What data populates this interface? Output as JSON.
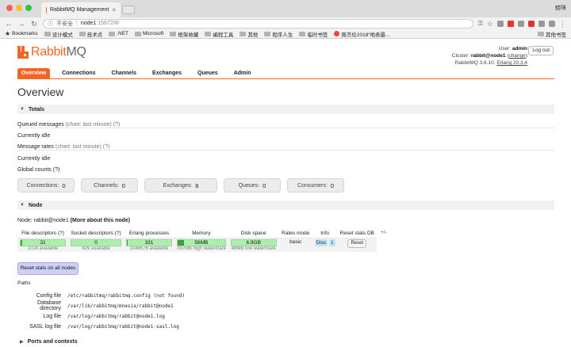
{
  "browser": {
    "tab_title": "RabbitMQ Management",
    "tab_close": "×",
    "user": "蛙咪",
    "insecure_label": "不安全",
    "separator": "|",
    "url_host": "node1",
    "url_path": ":15672/#/",
    "bookmarks": [
      "Bookmarks",
      "设计模式",
      "技术点",
      ".NET",
      "Microsoft",
      "框架收藏",
      "编程工具",
      "其他",
      "程序人生",
      "临时书签",
      "周杰伦2018“地表最..."
    ],
    "other_bookmarks": "其他书签"
  },
  "header": {
    "logo_text_a": "Rabbit",
    "logo_text_b": "MQ",
    "user_label": "User:",
    "user_value": "admin",
    "cluster_label": "Cluster:",
    "cluster_value": "rabbit@node1",
    "change_open": "(",
    "change_label": "change",
    "change_close": ")",
    "version_text": "RabbitMQ 3.6.10,",
    "erlang_text": "Erlang 20.3.4",
    "logout": "Log out"
  },
  "tabs": [
    "Overview",
    "Connections",
    "Channels",
    "Exchanges",
    "Queues",
    "Admin"
  ],
  "page_title": "Overview",
  "totals": {
    "section": "Totals",
    "queued_label": "Queued messages",
    "queued_hint": "(chart: last minute) (?)",
    "idle1": "Currently idle",
    "rates_label": "Message rates",
    "rates_hint": "(chart: last minute) (?)",
    "idle2": "Currently idle",
    "global_counts": "Global counts (?)",
    "counts": [
      {
        "label": "Connections:",
        "value": "0"
      },
      {
        "label": "Channels:",
        "value": "0"
      },
      {
        "label": "Exchanges:",
        "value": "8"
      },
      {
        "label": "Queues:",
        "value": "0"
      },
      {
        "label": "Consumers:",
        "value": "0"
      }
    ]
  },
  "node": {
    "section": "Node",
    "node_label": "Node: rabbit@node1",
    "more_link": "(More about this node)",
    "headers": [
      "File descriptors (?)",
      "Socket descriptors (?)",
      "Erlang processes",
      "Memory",
      "Disk space",
      "Rates mode",
      "Info",
      "Reset stats DB"
    ],
    "plusminus": "+/-",
    "file_desc": {
      "value": "31",
      "sub": "1024 available",
      "fraction": 0.03
    },
    "socket_desc": {
      "value": "0",
      "sub": "829 available",
      "fraction": 0.0
    },
    "erlang_proc": {
      "value": "331",
      "sub": "1048576 available",
      "fraction": 0.003
    },
    "memory": {
      "value": "56MB",
      "sub": "397MB high watermark",
      "fraction": 0.14
    },
    "disk": {
      "value": "6.9GB",
      "sub": "48MB low watermark",
      "fraction": 0.0
    },
    "rates_mode": "basic",
    "info_badges": [
      "Disc",
      "1"
    ],
    "reset_label": "Reset",
    "reset_all": "Reset stats on all nodes"
  },
  "paths": {
    "title": "Paths",
    "rows": [
      {
        "label": "Config file",
        "value": "/etc/rabbitmq/rabbitmq.config (not found)"
      },
      {
        "label": "Database directory",
        "value": "/var/lib/rabbitmq/mnesia/rabbit@node1"
      },
      {
        "label": "Log file",
        "value": "/var/log/rabbitmq/rabbit@node1.log"
      },
      {
        "label": "SASL log file",
        "value": "/var/log/rabbitmq/rabbit@node1-sasl.log"
      }
    ]
  },
  "ports_section": "Ports and contexts",
  "colors": {
    "accent": "#f26522",
    "bar_fill": "#3fa03f",
    "bar_bg": "#aaf0aa"
  }
}
